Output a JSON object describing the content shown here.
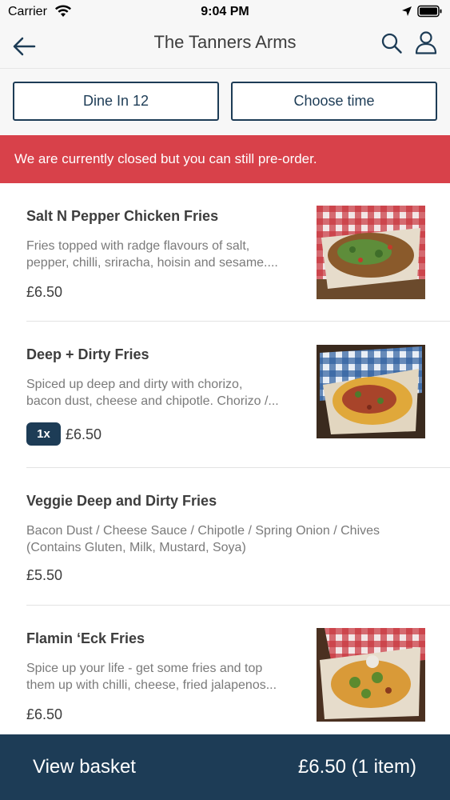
{
  "status_bar": {
    "carrier": "Carrier",
    "time": "9:04 PM"
  },
  "header": {
    "title": "The Tanners Arms"
  },
  "options": {
    "dine_in": "Dine In 12",
    "choose_time": "Choose time"
  },
  "banner": {
    "text": "We are currently closed but you can still pre-order."
  },
  "menu_items": [
    {
      "name": "Salt N Pepper Chicken Fries",
      "description_line1": "Fries topped with radge flavours of salt,",
      "description_line2": "pepper, chilli, sriracha, hoisin and sesame....",
      "price": "£6.50",
      "quantity": ""
    },
    {
      "name": "Deep + Dirty Fries",
      "description_line1": "Spiced up deep and dirty with chorizo,",
      "description_line2": "bacon dust, cheese and chipotle. Chorizo /...",
      "price": "£6.50",
      "quantity": "1x"
    },
    {
      "name": "Veggie Deep and Dirty Fries",
      "description_line1": "Bacon Dust / Cheese Sauce / Chipotle / Spring Onion / Chives",
      "description_line2": "(Contains Gluten, Milk, Mustard, Soya)",
      "price": "£5.50",
      "quantity": ""
    },
    {
      "name": "Flamin ‘Eck Fries",
      "description_line1": "Spice up your life - get some fries and top",
      "description_line2": "them up with chilli, cheese, fried jalapenos...",
      "price": "£6.50",
      "quantity": ""
    }
  ],
  "basket": {
    "label": "View basket",
    "total": "£6.50 (1 item)"
  },
  "colors": {
    "primary": "#1d3c56",
    "banner_red": "#d8414a",
    "header_bg": "#f7f7f7"
  }
}
